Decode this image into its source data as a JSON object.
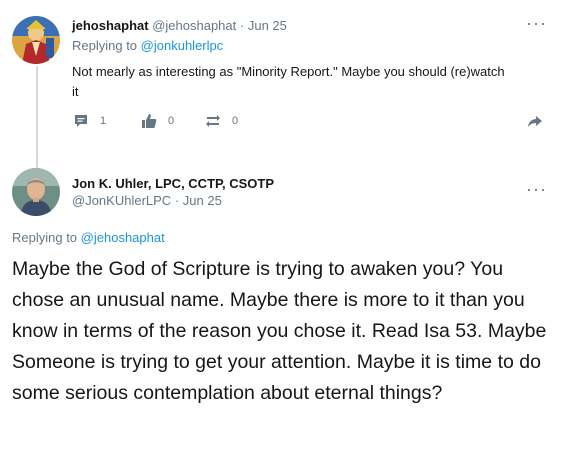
{
  "reply_tweet": {
    "author_name": "jehoshaphat",
    "author_handle": "@jehoshaphat",
    "separator": "·",
    "date": "Jun 25",
    "replying_prefix": "Replying to",
    "replying_to": "@jonkuhlerlpc",
    "text": "Not mearly as interesting as \"Minority Report.\" Maybe you should (re)watch it",
    "reply_count": "1",
    "like_count": "0",
    "retweet_count": "0",
    "more_label": "···",
    "icons": {
      "reply": "reply-icon",
      "like": "thumbs-up-icon",
      "retweet": "retweet-icon",
      "share": "share-icon"
    }
  },
  "main_tweet": {
    "author_name": "Jon K. Uhler, LPC, CCTP, CSOTP",
    "author_handle": "@JonKUhlerLPC",
    "separator": "·",
    "date": "Jun 25",
    "replying_prefix": "Replying to",
    "replying_to": "@jehoshaphat",
    "text": "Maybe the God of Scripture is trying to awaken you? You chose an unusual name. Maybe there is more to it than you know in terms of the reason you chose it. Read Isa 53. Maybe Someone is trying to get your attention. Maybe it is time to do some serious contemplation about eternal things?",
    "more_label": "···"
  },
  "colors": {
    "accent": "#1b95e0",
    "muted": "#657786",
    "text": "#14171a",
    "line": "#cfd9de"
  }
}
